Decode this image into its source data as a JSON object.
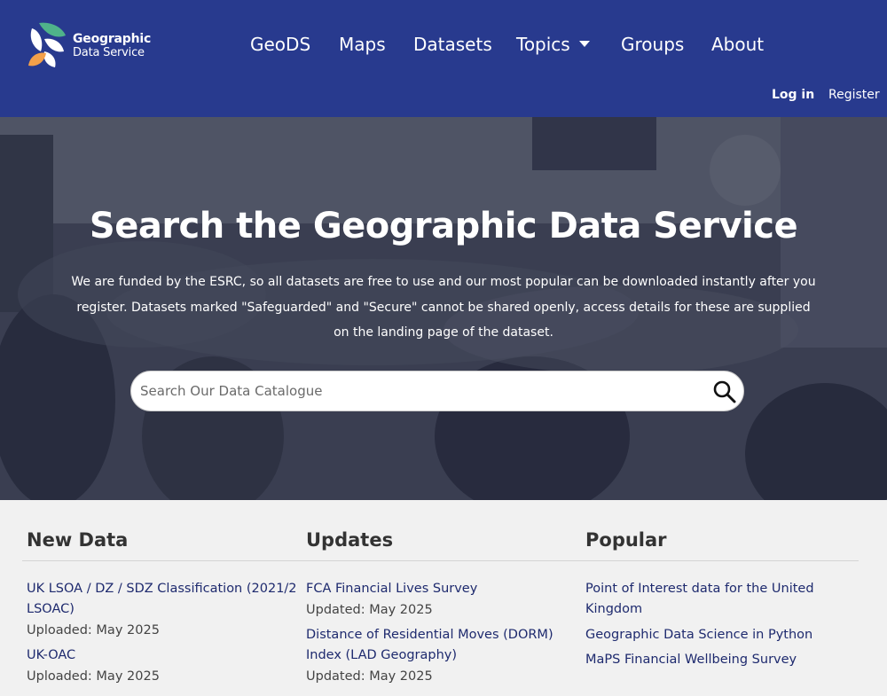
{
  "brand": {
    "line1": "Geographic",
    "line2": "Data Service",
    "colors": {
      "green": "#4fb38a",
      "orange": "#f3a04a",
      "white": "#ffffff"
    }
  },
  "nav": {
    "items": [
      "GeoDS",
      "Maps",
      "Datasets",
      "Topics",
      "Groups",
      "About"
    ],
    "login": "Log in",
    "register": "Register"
  },
  "hero": {
    "title": "Search the Geographic Data Service",
    "text": "We are funded by the ESRC, so all datasets are free to use and our most popular can be downloaded instantly after you register. Datasets marked \"Safeguarded\" and \"Secure\" cannot be shared openly, access details for these are supplied on the landing page of the dataset.",
    "search_placeholder": "Search Our Data Catalogue"
  },
  "columns": {
    "new_data": {
      "heading": "New Data",
      "items": [
        {
          "title": "UK LSOA / DZ / SDZ Classification (2021/2 LSOAC)",
          "meta": "Uploaded: May 2025"
        },
        {
          "title": "UK-OAC",
          "meta": "Uploaded: May 2025"
        }
      ]
    },
    "updates": {
      "heading": "Updates",
      "items": [
        {
          "title": "FCA Financial Lives Survey",
          "meta": "Updated: May 2025"
        },
        {
          "title": "Distance of Residential Moves (DORM) Index (LAD Geography)",
          "meta": "Updated: May 2025"
        }
      ]
    },
    "popular": {
      "heading": "Popular",
      "items": [
        {
          "title": "Point of Interest data for the United Kingdom"
        },
        {
          "title": "Geographic Data Science in Python"
        },
        {
          "title": "MaPS Financial Wellbeing Survey"
        }
      ]
    }
  },
  "theme": {
    "header_bg": "#283a8e",
    "link": "#1e2a6e",
    "page_bg": "#f1f1f1"
  }
}
